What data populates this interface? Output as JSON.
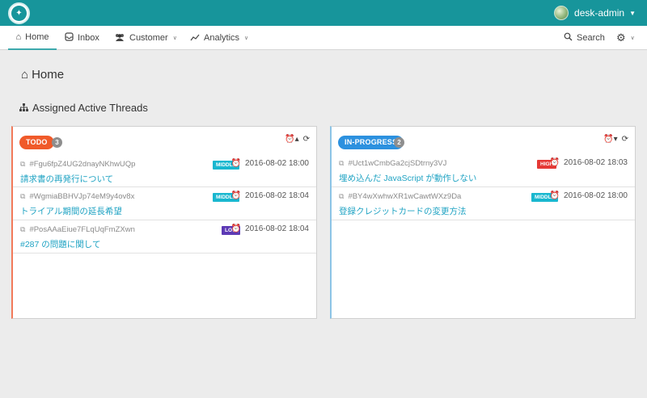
{
  "user": {
    "name": "desk-admin"
  },
  "nav": {
    "home": "Home",
    "inbox": "Inbox",
    "customer": "Customer",
    "analytics": "Analytics",
    "search": "Search"
  },
  "page": {
    "title": "Home",
    "section_title": "Assigned Active Threads"
  },
  "columns": [
    {
      "label": "TODO",
      "count": "3",
      "color": "#f05a2a",
      "threads": [
        {
          "id": "#Fgu6fpZ4UG2dnayNKhwUQp",
          "title": "請求書の再発行について",
          "priority": "MIDDLE",
          "date": "2016-08-02 18:00"
        },
        {
          "id": "#WgmiaBBHVJp74eM9y4ov8x",
          "title": "トライアル期間の延長希望",
          "priority": "MIDDLE",
          "date": "2016-08-02 18:04"
        },
        {
          "id": "#PosAAaEiue7FLqUqFmZXwn",
          "title": "#287 の問題に関して",
          "priority": "LOW",
          "date": "2016-08-02 18:04"
        }
      ]
    },
    {
      "label": "IN-PROGRESS",
      "count": "2",
      "color": "#2c91df",
      "threads": [
        {
          "id": "#Uct1wCmbGa2cjSDtrny3VJ",
          "title": "埋め込んだ JavaScript が動作しない",
          "priority": "HIGH",
          "date": "2016-08-02 18:03"
        },
        {
          "id": "#BY4wXwhwXR1wCawtWXz9Da",
          "title": "登録クレジットカードの変更方法",
          "priority": "MIDDLE",
          "date": "2016-08-02 18:00"
        }
      ]
    }
  ],
  "icons": {
    "logo": "logo-icon",
    "home": "home-icon",
    "inbox": "inbox-icon",
    "customer": "users-icon",
    "analytics": "chart-icon",
    "search": "search-icon",
    "settings": "gear-icon",
    "thread": "hierarchy-icon",
    "alarm": "alarm-clock-icon",
    "refresh": "refresh-icon"
  },
  "colors": {
    "topbar": "#17959b",
    "link": "#1fa3c3",
    "middle": "#19b7cf",
    "low": "#5d3ab5",
    "high": "#e53935"
  }
}
